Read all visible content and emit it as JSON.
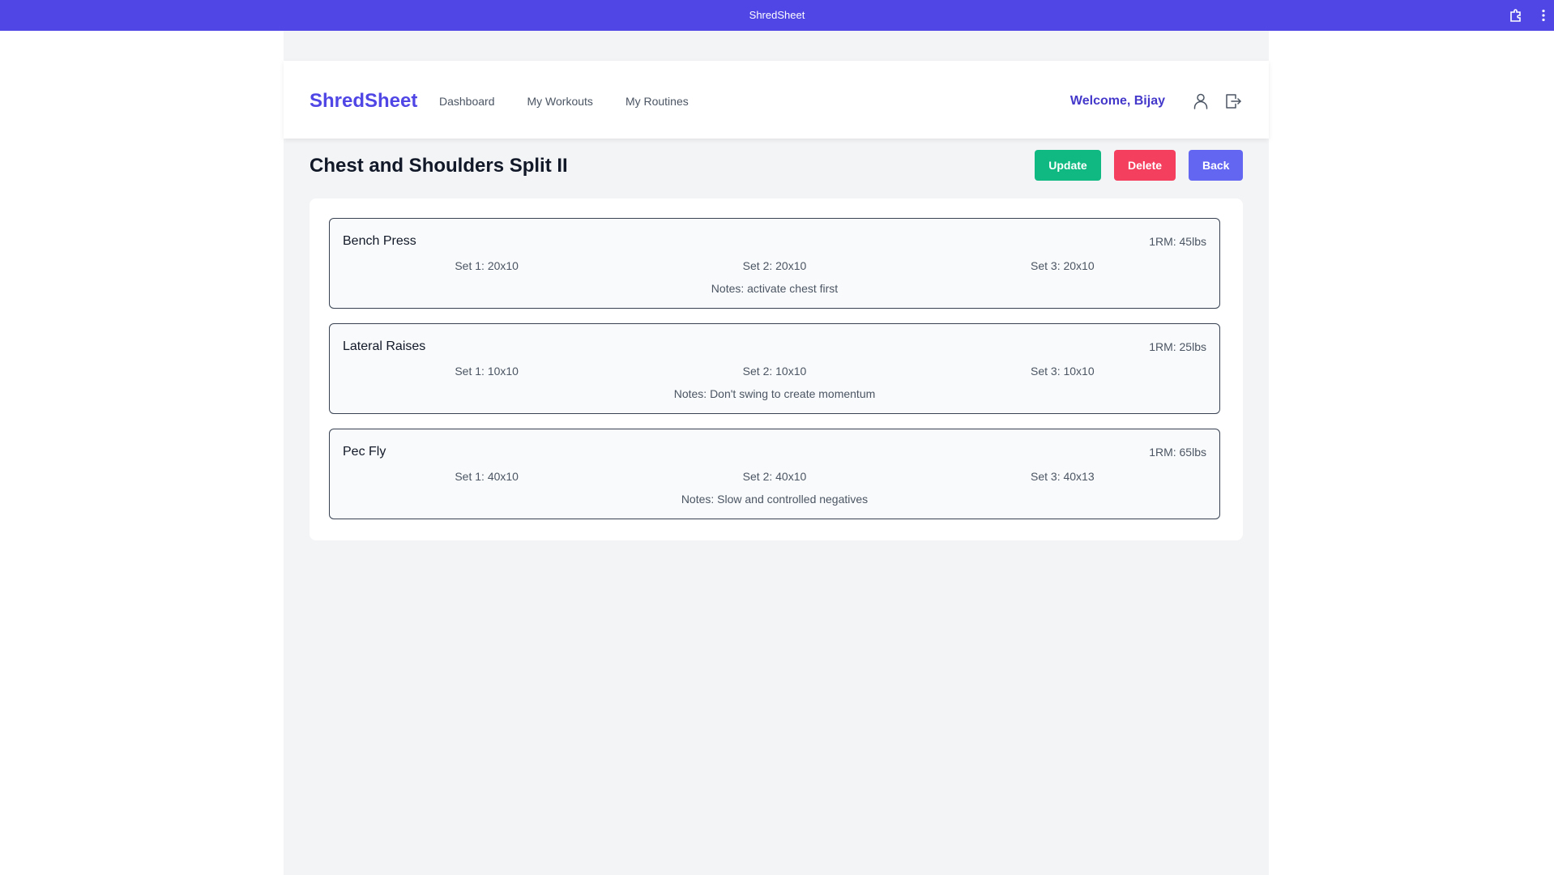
{
  "window": {
    "title": "ShredSheet",
    "icons": [
      "extension-icon",
      "more-vertical-icon"
    ]
  },
  "navbar": {
    "logo": "ShredSheet",
    "links": [
      "Dashboard",
      "My Workouts",
      "My Routines"
    ],
    "welcome": "Welcome, Bijay",
    "icons": [
      "user-icon",
      "logout-icon"
    ]
  },
  "page": {
    "title": "Chest and Shoulders Split II",
    "actions": {
      "update": "Update",
      "delete": "Delete",
      "back": "Back"
    }
  },
  "exercises": [
    {
      "name": "Bench Press",
      "one_rm": "1RM: 45lbs",
      "sets": [
        "Set 1: 20x10",
        "Set 2: 20x10",
        "Set 3: 20x10"
      ],
      "notes": "Notes: activate chest first"
    },
    {
      "name": "Lateral Raises",
      "one_rm": "1RM: 25lbs",
      "sets": [
        "Set 1: 10x10",
        "Set 2: 10x10",
        "Set 3: 10x10"
      ],
      "notes": "Notes: Don't swing to create momentum"
    },
    {
      "name": "Pec Fly",
      "one_rm": "1RM: 65lbs",
      "sets": [
        "Set 1: 40x10",
        "Set 2: 40x10",
        "Set 3: 40x13"
      ],
      "notes": "Notes: Slow and controlled negatives"
    }
  ],
  "colors": {
    "brand": "#4f46e5",
    "update": "#10b981",
    "delete": "#f43f5e",
    "back": "#6366f1"
  }
}
